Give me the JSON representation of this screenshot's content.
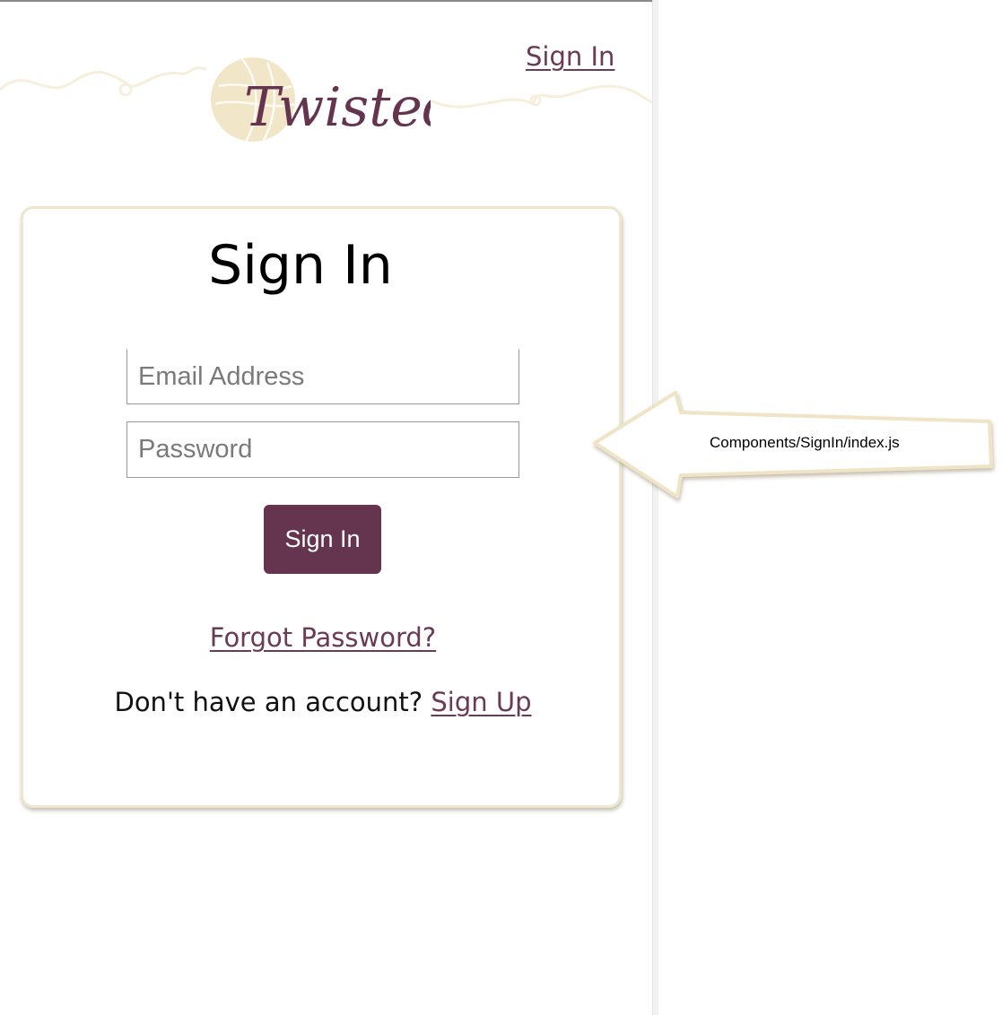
{
  "header": {
    "brand_name": "Twisted",
    "nav_signin_label": "Sign In"
  },
  "card": {
    "title": "Sign In",
    "email_placeholder": "Email Address",
    "password_placeholder": "Password",
    "submit_label": "Sign In",
    "forgot_label": "Forgot Password?",
    "signup_prompt": "Don't have an account? ",
    "signup_label": "Sign Up"
  },
  "annotation": {
    "label": "Components/SignIn/index.js"
  },
  "colors": {
    "brand": "#65344f",
    "link": "#6b3a55",
    "logo_yarn": "#f2e6c9",
    "card_border": "#f0e6cf"
  }
}
